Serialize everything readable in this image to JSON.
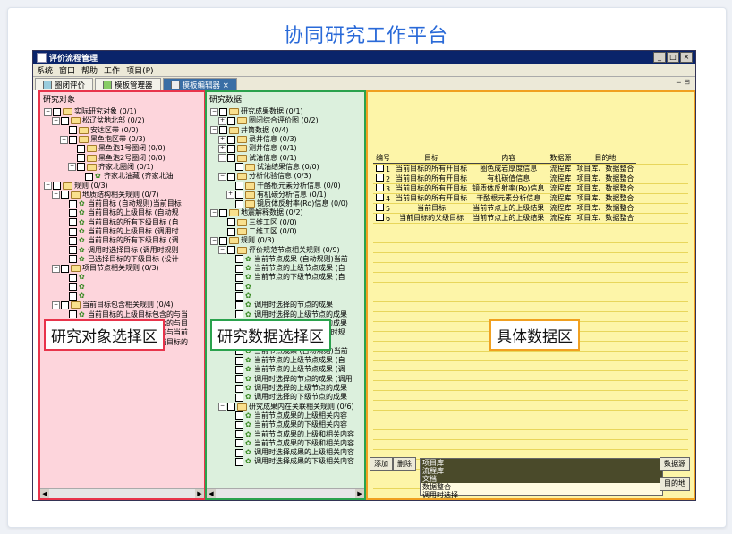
{
  "page_title": "协同研究工作平台",
  "window": {
    "title": "评价流程管理",
    "menu": [
      "系统",
      "窗口",
      "帮助",
      "工作",
      "项目(P)"
    ],
    "controls": [
      "_",
      "□",
      "×"
    ]
  },
  "tabs": [
    {
      "label": "圈闭评价"
    },
    {
      "label": "模板管理器"
    },
    {
      "label": "模板编辑器 ×"
    }
  ],
  "tabbar_right": "= ⊟",
  "panel1": {
    "header": "研究对象",
    "overlay": "研究对象选择区",
    "nodes": [
      {
        "indent": 0,
        "exp": "-",
        "text": "实际研究对象 (0/1)",
        "icon": "folder"
      },
      {
        "indent": 1,
        "exp": "-",
        "text": "松辽盆地北部 (0/2)",
        "icon": "folder"
      },
      {
        "indent": 2,
        "exp": "",
        "text": "安达区带 (0/0)",
        "icon": "folder"
      },
      {
        "indent": 2,
        "exp": "-",
        "text": "黑鱼泡区带 (0/3)",
        "icon": "folder"
      },
      {
        "indent": 3,
        "exp": "",
        "text": "黑鱼泡1号圈闭 (0/0)",
        "icon": "folder"
      },
      {
        "indent": 3,
        "exp": "",
        "text": "黑鱼泡2号圈闭 (0/0)",
        "icon": "folder"
      },
      {
        "indent": 3,
        "exp": "-",
        "text": "齐家北圈闭 (0/1)",
        "icon": "folder"
      },
      {
        "indent": 4,
        "exp": "",
        "text": "齐家北油藏 (齐家北油",
        "icon": "leaf"
      },
      {
        "indent": 0,
        "exp": "-",
        "text": "规则 (0/3)",
        "icon": "folder"
      },
      {
        "indent": 1,
        "exp": "-",
        "text": "地质结构相关规则 (0/7)",
        "icon": "folder"
      },
      {
        "indent": 2,
        "exp": "",
        "text": "当前目标 (自动规则)当前目标",
        "icon": "leaf"
      },
      {
        "indent": 2,
        "exp": "",
        "text": "当前目标的上级目标 (自动规",
        "icon": "leaf"
      },
      {
        "indent": 2,
        "exp": "",
        "text": "当前目标的所有下级目标 (自",
        "icon": "leaf"
      },
      {
        "indent": 2,
        "exp": "",
        "text": "当前目标的上级目标 (调用时",
        "icon": "leaf"
      },
      {
        "indent": 2,
        "exp": "",
        "text": "当前目标的所有下级目标 (调",
        "icon": "leaf"
      },
      {
        "indent": 2,
        "exp": "",
        "text": "调用时选择目标 (调用时规则",
        "icon": "leaf"
      },
      {
        "indent": 2,
        "exp": "",
        "text": "已选择目标的下级目标 (设计",
        "icon": "leaf"
      },
      {
        "indent": 1,
        "exp": "-",
        "text": "项目节点相关规则 (0/3)",
        "icon": "folder"
      },
      {
        "indent": 2,
        "exp": "",
        "text": "",
        "icon": "leaf"
      },
      {
        "indent": 2,
        "exp": "",
        "text": "",
        "icon": "leaf"
      },
      {
        "indent": 2,
        "exp": "",
        "text": "",
        "icon": "leaf"
      },
      {
        "indent": 1,
        "exp": "-",
        "text": "当前目标包含相关规则 (0/4)",
        "icon": "folder"
      },
      {
        "indent": 2,
        "exp": "",
        "text": "当前目标的上级目标包含的与当",
        "icon": "leaf"
      },
      {
        "indent": 2,
        "exp": "",
        "text": "当前目标的上级目标包含的与目",
        "icon": "leaf"
      },
      {
        "indent": 2,
        "exp": "",
        "text": "调用时选择的目标包含的与当前",
        "icon": "leaf"
      },
      {
        "indent": 2,
        "exp": "",
        "text": "已选择目标包含的与当前目标的",
        "icon": "leaf"
      }
    ]
  },
  "panel2": {
    "header": "研究数据",
    "overlay": "研究数据选择区",
    "nodes": [
      {
        "indent": 0,
        "exp": "-",
        "text": "研究成果数据 (0/1)",
        "icon": "folder"
      },
      {
        "indent": 1,
        "exp": "+",
        "text": "圈闭综合评价图 (0/2)",
        "icon": "folder"
      },
      {
        "indent": 0,
        "exp": "-",
        "text": "井筒数据 (0/4)",
        "icon": "folder"
      },
      {
        "indent": 1,
        "exp": "+",
        "text": "录井信息 (0/3)",
        "icon": "folder"
      },
      {
        "indent": 1,
        "exp": "+",
        "text": "测井信息 (0/1)",
        "icon": "folder"
      },
      {
        "indent": 1,
        "exp": "-",
        "text": "试油信息 (0/1)",
        "icon": "folder"
      },
      {
        "indent": 2,
        "exp": "",
        "text": "试油结果信息 (0/0)",
        "icon": "folder"
      },
      {
        "indent": 1,
        "exp": "-",
        "text": "分析化验信息 (0/3)",
        "icon": "folder"
      },
      {
        "indent": 2,
        "exp": "",
        "text": "干酪根元素分析信息 (0/0)",
        "icon": "folder"
      },
      {
        "indent": 2,
        "exp": "+",
        "text": "有机碳分析信息 (0/1)",
        "icon": "folder"
      },
      {
        "indent": 2,
        "exp": "",
        "text": "镜质体反射率(Ro)信息 (0/0)",
        "icon": "folder"
      },
      {
        "indent": 0,
        "exp": "-",
        "text": "地震解释数据 (0/2)",
        "icon": "folder"
      },
      {
        "indent": 1,
        "exp": "",
        "text": "三维工区 (0/0)",
        "icon": "folder"
      },
      {
        "indent": 1,
        "exp": "",
        "text": "二维工区 (0/0)",
        "icon": "folder"
      },
      {
        "indent": 0,
        "exp": "-",
        "text": "规则 (0/3)",
        "icon": "folder"
      },
      {
        "indent": 1,
        "exp": "-",
        "text": "评价规范节点相关规则 (0/9)",
        "icon": "folder"
      },
      {
        "indent": 2,
        "exp": "",
        "text": "当前节点成果 (自动规则)当前",
        "icon": "leaf"
      },
      {
        "indent": 2,
        "exp": "",
        "text": "当前节点的上级节点成果 (自",
        "icon": "leaf"
      },
      {
        "indent": 2,
        "exp": "",
        "text": "当前节点的下级节点成果 (自",
        "icon": "leaf"
      },
      {
        "indent": 2,
        "exp": "",
        "text": "",
        "icon": "leaf"
      },
      {
        "indent": 2,
        "exp": "",
        "text": "",
        "icon": "leaf"
      },
      {
        "indent": 2,
        "exp": "",
        "text": "调用时选择的节点的成果",
        "icon": "leaf"
      },
      {
        "indent": 2,
        "exp": "",
        "text": "调用时选择的上级节点的成果",
        "icon": "leaf"
      },
      {
        "indent": 2,
        "exp": "",
        "text": "调用时选择的下级节点的成果",
        "icon": "leaf"
      },
      {
        "indent": 2,
        "exp": "",
        "text": "调用时选择的成果 (调用时规",
        "icon": "leaf"
      },
      {
        "indent": 1,
        "exp": "-",
        "text": "项目节点相关规则 (0/6)",
        "icon": "folder"
      },
      {
        "indent": 2,
        "exp": "",
        "text": "当前节点成果 (自动规则)当前",
        "icon": "leaf"
      },
      {
        "indent": 2,
        "exp": "",
        "text": "当前节点的上级节点成果 (自",
        "icon": "leaf"
      },
      {
        "indent": 2,
        "exp": "",
        "text": "当前节点的上级节点成果 (调",
        "icon": "leaf"
      },
      {
        "indent": 2,
        "exp": "",
        "text": "调用时选择的节点的成果 (调用",
        "icon": "leaf"
      },
      {
        "indent": 2,
        "exp": "",
        "text": "调用时选择的上级节点的成果",
        "icon": "leaf"
      },
      {
        "indent": 2,
        "exp": "",
        "text": "调用时选择的下级节点的成果",
        "icon": "leaf"
      },
      {
        "indent": 1,
        "exp": "-",
        "text": "研究成果内在关联相关规则 (0/6)",
        "icon": "folder"
      },
      {
        "indent": 2,
        "exp": "",
        "text": "当前节点成果的上级相关内容",
        "icon": "leaf"
      },
      {
        "indent": 2,
        "exp": "",
        "text": "当前节点成果的下级相关内容",
        "icon": "leaf"
      },
      {
        "indent": 2,
        "exp": "",
        "text": "当前节点成果的上级和相关内容",
        "icon": "leaf"
      },
      {
        "indent": 2,
        "exp": "",
        "text": "当前节点成果的下级和相关内容",
        "icon": "leaf"
      },
      {
        "indent": 2,
        "exp": "",
        "text": "调用时选择成果的上级相关内容",
        "icon": "leaf"
      },
      {
        "indent": 2,
        "exp": "",
        "text": "调用时选择成果的下级相关内容",
        "icon": "leaf"
      }
    ]
  },
  "panel3": {
    "overlay": "具体数据区",
    "columns": [
      "编号",
      "目标",
      "内容",
      "数据源",
      "目的地"
    ],
    "rows": [
      [
        "1",
        "当前目标的所有开目标",
        "圈色成岩厚度信息",
        "流程库",
        "项目库、数据整合"
      ],
      [
        "2",
        "当前目标的所有开目标",
        "有机碳值信息",
        "流程库",
        "项目库、数据整合"
      ],
      [
        "3",
        "当前目标的所有开目标",
        "镜质体反射率(Ro)信息",
        "流程库",
        "项目库、数据整合"
      ],
      [
        "4",
        "当前目标的所有开目标",
        "干酪根元素分析信息",
        "流程库",
        "项目库、数据整合"
      ],
      [
        "5",
        "当前目标",
        "当前节点上的上级结果",
        "流程库",
        "项目库、数据整合"
      ],
      [
        "6",
        "当前目标的父级目标",
        "当前节点上的上级结果",
        "流程库",
        "项目库、数据整合"
      ]
    ],
    "buttons": {
      "add": "添加",
      "delete": "删除",
      "datasource": "数据源",
      "destination": "目的地"
    },
    "listbox": [
      "项目库",
      "流程库",
      "文档",
      "数据整合",
      "调用时选择"
    ],
    "listbox_selected": [
      0,
      1,
      2
    ]
  }
}
